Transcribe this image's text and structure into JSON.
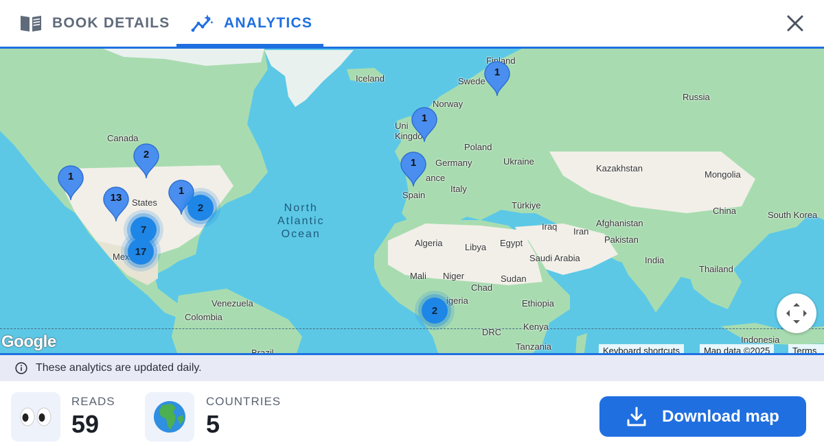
{
  "header": {
    "tabs": [
      {
        "label": "BOOK DETAILS",
        "icon": "book-open-icon",
        "active": false
      },
      {
        "label": "ANALYTICS",
        "icon": "analytics-sparkle-icon",
        "active": true
      }
    ],
    "close_icon": "close-icon"
  },
  "map": {
    "labels": {
      "finland": "Finland",
      "iceland": "Iceland",
      "sweden": "Swede",
      "norway": "Norway",
      "russia": "Russia",
      "uk": "Uni\nKingdo",
      "poland": "Poland",
      "germany": "Germany",
      "ukraine": "Ukraine",
      "france": "ance",
      "italy": "Italy",
      "spain": "Spain",
      "kazakhstan": "Kazakhstan",
      "mongolia": "Mongolia",
      "turkiye": "Türkiye",
      "china": "China",
      "south_korea": "South Korea",
      "iraq": "Iraq",
      "iran": "Iran",
      "afghanistan": "Afghanistan",
      "pakistan": "Pakistan",
      "india": "India",
      "thailand": "Thailand",
      "canada": "Canada",
      "states": "States",
      "mexico": "Mexi",
      "algeria": "Algeria",
      "libya": "Libya",
      "egypt": "Egypt",
      "saudi_arabia": "Saudi Arabia",
      "mali": "Mali",
      "niger": "Niger",
      "chad": "Chad",
      "sudan": "Sudan",
      "nigeria": "igeria",
      "ethiopia": "Ethiopia",
      "kenya": "Kenya",
      "drc": "DRC",
      "tanzania": "Tanzania",
      "venezuela": "Venezuela",
      "colombia": "Colombia",
      "brazil": "Brazil",
      "indonesia": "Indonesia",
      "ocean": "North\nAtlantic\nOcean"
    },
    "markers": [
      {
        "id": "finland",
        "count": "1"
      },
      {
        "id": "uk",
        "count": "1"
      },
      {
        "id": "spain",
        "count": "1"
      },
      {
        "id": "canada",
        "count": "2"
      },
      {
        "id": "us-west",
        "count": "1"
      },
      {
        "id": "us-central",
        "count": "13"
      },
      {
        "id": "us-east",
        "count": "1"
      }
    ],
    "clusters": [
      {
        "id": "us-northeast",
        "count": "2"
      },
      {
        "id": "texas",
        "count": "7"
      },
      {
        "id": "mexico",
        "count": "17"
      },
      {
        "id": "nigeria",
        "count": "2"
      }
    ],
    "attribution": {
      "logo": "Google",
      "keyboard": "Keyboard shortcuts",
      "mapdata": "Map data ©2025",
      "terms": "Terms"
    }
  },
  "info": {
    "text": "These analytics are updated daily.",
    "icon": "info-circle-icon"
  },
  "stats": {
    "reads": {
      "label": "READS",
      "value": "59",
      "icon": "eyes-icon"
    },
    "countries": {
      "label": "COUNTRIES",
      "value": "5",
      "icon": "globe-africa-icon"
    }
  },
  "download": {
    "label": "Download map",
    "icon": "download-icon"
  },
  "colors": {
    "accent": "#1f6fe0",
    "ocean": "#5cc8e6",
    "land": "#a8dcb0",
    "desert": "#f2efe8"
  }
}
